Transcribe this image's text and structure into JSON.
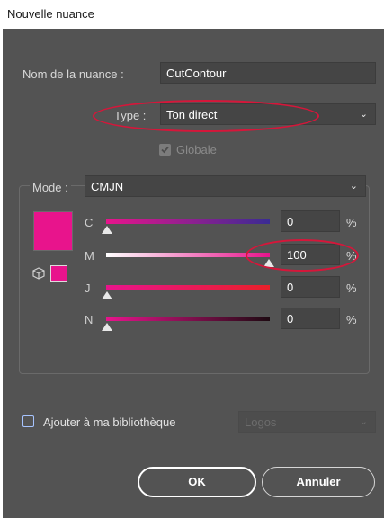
{
  "window": {
    "title": "Nouvelle nuance"
  },
  "swatch_name": {
    "label": "Nom de la nuance :",
    "value": "CutContour"
  },
  "type": {
    "label": "Type :",
    "value": "Ton direct"
  },
  "global": {
    "label": "Globale",
    "checked": true
  },
  "mode": {
    "label": "Mode :",
    "value": "CMJN"
  },
  "color": {
    "swatch": "#e8148c",
    "mini_swatch": "#e8148c"
  },
  "channels": [
    {
      "letter": "C",
      "value": "0",
      "unit": "%",
      "level": 0
    },
    {
      "letter": "M",
      "value": "100",
      "unit": "%",
      "level": 100
    },
    {
      "letter": "J",
      "value": "0",
      "unit": "%",
      "level": 0
    },
    {
      "letter": "N",
      "value": "0",
      "unit": "%",
      "level": 0
    }
  ],
  "library": {
    "label": "Ajouter à ma bibliothèque",
    "checked": false,
    "select_value": "Logos"
  },
  "buttons": {
    "ok": "OK",
    "cancel": "Annuler"
  },
  "colors": {
    "annotation": "#d6163a",
    "dialog_bg": "#535353",
    "accent": "#e8148c"
  }
}
